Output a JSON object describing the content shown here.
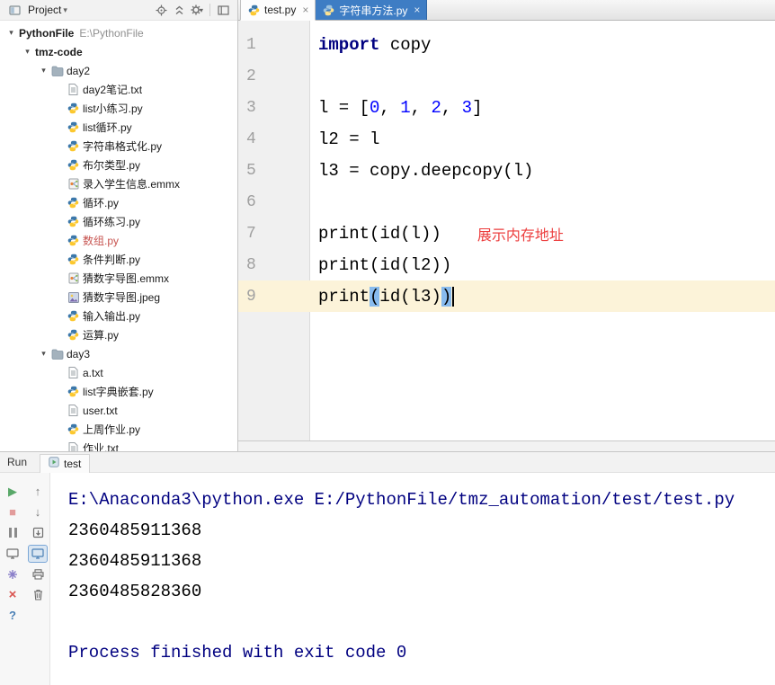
{
  "colors": {
    "keyword": "#000080",
    "number": "#0000ff",
    "plain": "#000000",
    "console-info": "#000080",
    "annotation-red": "#ec3d3d",
    "tab-blue": "#3e7dc4",
    "current-line": "#fcf3d9",
    "paren-highlight": "#88bbee",
    "gutter-bg": "#f0f0f0",
    "panel-bg": "#f2f2f2",
    "error-file-red": "#c75450"
  },
  "icons": {
    "play": "▶",
    "stop": "■",
    "up": "↑",
    "down": "↓",
    "close": "×",
    "help": "?",
    "dropdown": "▾",
    "chevron": "▾"
  },
  "project_panel": {
    "title": "Project",
    "tree": [
      {
        "level": 0,
        "type": "root",
        "label": "PythonFile",
        "path": "E:\\PythonFile",
        "bold": true,
        "expandable": true
      },
      {
        "level": 1,
        "type": "root",
        "label": "tmz-code",
        "bold": true,
        "expandable": true
      },
      {
        "level": 2,
        "type": "folder",
        "label": "day2",
        "expandable": true
      },
      {
        "level": 3,
        "type": "text",
        "label": "day2笔记.txt"
      },
      {
        "level": 3,
        "type": "python",
        "label": "list小练习.py"
      },
      {
        "level": 3,
        "type": "python",
        "label": "list循环.py"
      },
      {
        "level": 3,
        "type": "python",
        "label": "字符串格式化.py"
      },
      {
        "level": 3,
        "type": "python",
        "label": "布尔类型.py"
      },
      {
        "level": 3,
        "type": "emmx",
        "label": "录入学生信息.emmx"
      },
      {
        "level": 3,
        "type": "python",
        "label": "循环.py"
      },
      {
        "level": 3,
        "type": "python",
        "label": "循环练习.py"
      },
      {
        "level": 3,
        "type": "python",
        "label": "数组.py",
        "color": "red"
      },
      {
        "level": 3,
        "type": "python",
        "label": "条件判断.py"
      },
      {
        "level": 3,
        "type": "emmx",
        "label": "猜数字导图.emmx"
      },
      {
        "level": 3,
        "type": "image",
        "label": "猜数字导图.jpeg"
      },
      {
        "level": 3,
        "type": "python",
        "label": "输入输出.py"
      },
      {
        "level": 3,
        "type": "python",
        "label": "运算.py"
      },
      {
        "level": 2,
        "type": "folder",
        "label": "day3",
        "expandable": true
      },
      {
        "level": 3,
        "type": "text",
        "label": "a.txt"
      },
      {
        "level": 3,
        "type": "python",
        "label": "list字典嵌套.py"
      },
      {
        "level": 3,
        "type": "text",
        "label": "user.txt"
      },
      {
        "level": 3,
        "type": "python",
        "label": "上周作业.py"
      },
      {
        "level": 3,
        "type": "text",
        "label": "作业.txt"
      }
    ]
  },
  "editor": {
    "tabs": [
      {
        "label": "test.py",
        "state": "active"
      },
      {
        "label": "字符串方法.py",
        "state": "selected-blue"
      }
    ],
    "lines": [
      {
        "num": "1",
        "segments": [
          {
            "text": "import",
            "style": "keyword"
          },
          {
            "text": " copy",
            "style": "plain"
          }
        ]
      },
      {
        "num": "2",
        "segments": []
      },
      {
        "num": "3",
        "segments": [
          {
            "text": "l = [",
            "style": "plain"
          },
          {
            "text": "0",
            "style": "number"
          },
          {
            "text": ", ",
            "style": "plain"
          },
          {
            "text": "1",
            "style": "number"
          },
          {
            "text": ", ",
            "style": "plain"
          },
          {
            "text": "2",
            "style": "number"
          },
          {
            "text": ", ",
            "style": "plain"
          },
          {
            "text": "3",
            "style": "number"
          },
          {
            "text": "]",
            "style": "plain"
          }
        ]
      },
      {
        "num": "4",
        "segments": [
          {
            "text": "l2 = l",
            "style": "plain"
          }
        ]
      },
      {
        "num": "5",
        "segments": [
          {
            "text": "l3 = copy.deepcopy(l)",
            "style": "plain"
          }
        ]
      },
      {
        "num": "6",
        "segments": []
      },
      {
        "num": "7",
        "segments": [
          {
            "text": "print(id(l))",
            "style": "plain"
          }
        ],
        "annotation": "展示内存地址"
      },
      {
        "num": "8",
        "segments": [
          {
            "text": "print(id(l2))",
            "style": "plain"
          }
        ]
      },
      {
        "num": "9",
        "current": true,
        "caret": true,
        "segments": [
          {
            "text": "print",
            "style": "plain"
          },
          {
            "text": "(",
            "style": "paren"
          },
          {
            "text": "id(l3)",
            "style": "plain"
          },
          {
            "text": ")",
            "style": "paren"
          }
        ]
      }
    ]
  },
  "run_panel": {
    "title": "Run",
    "tab": "test",
    "console": [
      {
        "text": "E:\\Anaconda3\\python.exe E:/PythonFile/tmz_automation/test/test.py",
        "style": "info"
      },
      {
        "text": "2360485911368",
        "style": "plain"
      },
      {
        "text": "2360485911368",
        "style": "plain"
      },
      {
        "text": "2360485828360",
        "style": "plain"
      },
      {
        "text": "",
        "style": "plain"
      },
      {
        "text": "Process finished with exit code 0",
        "style": "info"
      }
    ]
  }
}
